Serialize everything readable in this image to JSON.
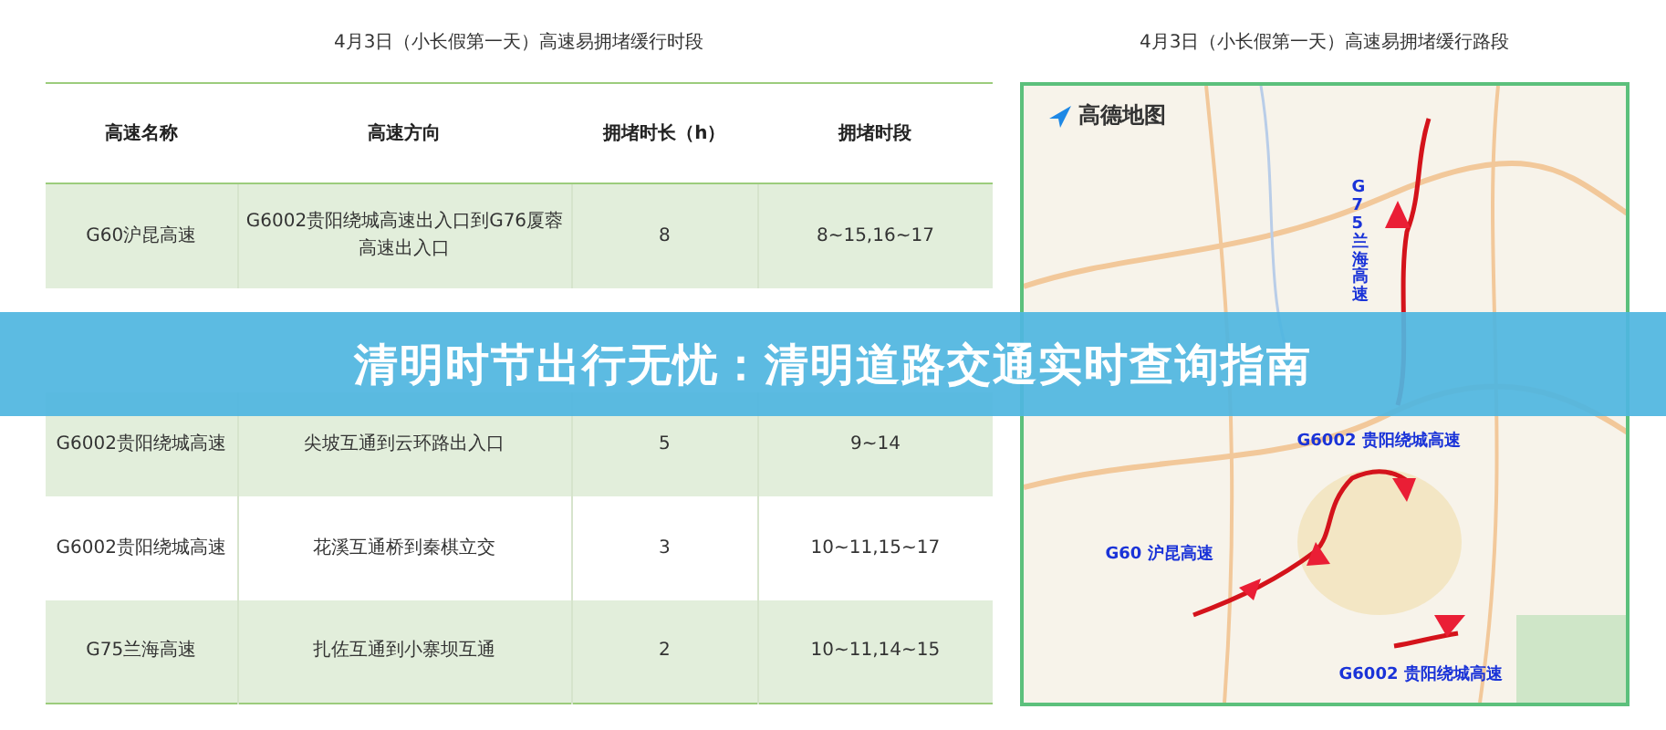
{
  "table_panel": {
    "title": "4月3日（小长假第一天）高速易拥堵缓行时段",
    "columns": [
      "高速名称",
      "高速方向",
      "拥堵时长（h）",
      "拥堵时段"
    ],
    "rows": [
      {
        "cells": [
          "G60沪昆高速",
          "G6002贵阳绕城高速出入口到G76厦蓉高速出入口",
          "8",
          "8~15,16~17"
        ]
      },
      {
        "cells": [
          "G6002贵阳绕城高速",
          "尖坡互通到云环路出入口",
          "5",
          "9~14"
        ]
      },
      {
        "cells": [
          "G6002贵阳绕城高速",
          "花溪互通桥到秦棋立交",
          "3",
          "10~11,15~17"
        ]
      },
      {
        "cells": [
          "G75兰海高速",
          "扎佐互通到小寨坝互通",
          "2",
          "10~11,14~15"
        ]
      }
    ]
  },
  "map_panel": {
    "title": "4月3日（小长假第一天）高速易拥堵缓行路段",
    "logo": "高德地图",
    "route_labels": [
      "G75兰海高速",
      "G6002 贵阳绕城高速",
      "G60 沪昆高速",
      "G6002 贵阳绕城高速"
    ]
  },
  "banner": {
    "title": "清明时节出行无忧：清明道路交通实时查询指南"
  }
}
